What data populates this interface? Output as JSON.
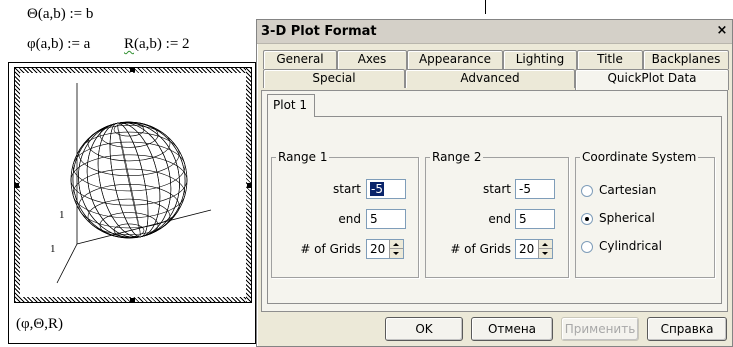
{
  "worksheet": {
    "line1": "Θ(a,b) := b",
    "line2": "φ(a,b) := a",
    "eq2_name": "R",
    "eq2_rest": "(a,b) := 2",
    "plot_caption": "(φ,Θ,R)",
    "axis_tick_1": "1",
    "axis_tick_2": "1"
  },
  "dialog": {
    "title": "3-D Plot Format",
    "close_glyph": "×",
    "tabs_row1": [
      "General",
      "Axes",
      "Appearance",
      "Lighting",
      "Title",
      "Backplanes"
    ],
    "tabs_row2": [
      "Special",
      "Advanced",
      "QuickPlot Data"
    ],
    "active_tab": "QuickPlot Data",
    "subtab": "Plot 1",
    "range1": {
      "title": "Range 1",
      "start_label": "start",
      "start_value": "-5",
      "end_label": "end",
      "end_value": "5",
      "grids_label": "# of Grids",
      "grids_value": "20"
    },
    "range2": {
      "title": "Range 2",
      "start_label": "start",
      "start_value": "-5",
      "end_label": "end",
      "end_value": "5",
      "grids_label": "# of Grids",
      "grids_value": "20"
    },
    "coord": {
      "title": "Coordinate System",
      "options": [
        "Cartesian",
        "Spherical",
        "Cylindrical"
      ],
      "selected": "Spherical"
    },
    "buttons": {
      "ok": "OK",
      "cancel": "Отмена",
      "apply": "Применить",
      "help": "Справка"
    }
  },
  "colors": {
    "dialog_bg": "#ece9d8",
    "selection": "#0a246a",
    "sphere_line": "#000000"
  }
}
